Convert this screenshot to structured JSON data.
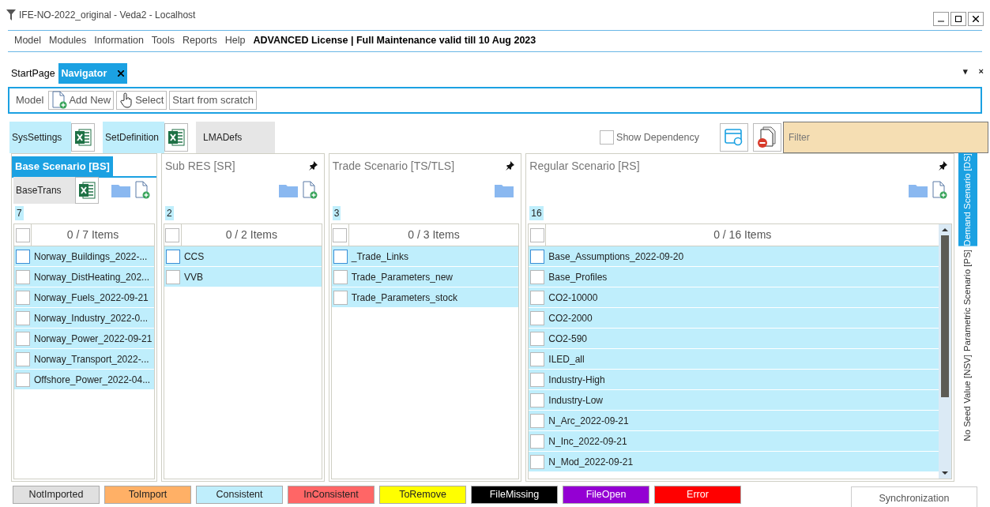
{
  "window": {
    "title": "IFE-NO-2022_original - Veda2 - Localhost"
  },
  "menu": [
    "Model",
    "Modules",
    "Information",
    "Tools",
    "Reports",
    "Help"
  ],
  "license": "ADVANCED License | Full Maintenance valid till 10 Aug 2023",
  "tabs": [
    {
      "label": "StartPage",
      "selected": false,
      "closable": false
    },
    {
      "label": "Navigator",
      "selected": true,
      "closable": true
    }
  ],
  "tab_strip_controls": [
    "▾",
    "×"
  ],
  "toolbar": {
    "label": "Model",
    "buttons": [
      {
        "label": "Add New",
        "kind": "add"
      },
      {
        "label": "Select",
        "kind": "select"
      },
      {
        "label": "Start from scratch",
        "kind": "plain"
      }
    ]
  },
  "files": [
    {
      "label": "SysSettings",
      "color": "#bfeefc",
      "excel": true
    },
    {
      "label": "SetDefinition",
      "color": "#bfeefc",
      "excel": true
    },
    {
      "label": "LMADefs",
      "color": "#e6e6e6",
      "excel": false
    }
  ],
  "show_dependency": {
    "label": "Show Dependency",
    "checked": false
  },
  "filter": {
    "placeholder": "Filter"
  },
  "panels": [
    {
      "title": "Base Scenario [BS]",
      "selected": true,
      "pinned": false,
      "file": {
        "label": "BaseTrans",
        "color": "#e6e6e6"
      },
      "add_file": true,
      "count": "7",
      "summary": "0 / 7 Items",
      "all_checked": false,
      "scrollbar": false,
      "items": [
        {
          "label": "Norway_Buildings_2022-...",
          "checked": false,
          "color": "#bfeefc"
        },
        {
          "label": "Norway_DistHeating_202...",
          "checked": false,
          "color": "#bfeefc"
        },
        {
          "label": "Norway_Fuels_2022-09-21",
          "checked": false,
          "color": "#bfeefc"
        },
        {
          "label": "Norway_Industry_2022-0...",
          "checked": false,
          "color": "#bfeefc"
        },
        {
          "label": "Norway_Power_2022-09-21",
          "checked": false,
          "color": "#bfeefc"
        },
        {
          "label": "Norway_Transport_2022-...",
          "checked": false,
          "color": "#bfeefc"
        },
        {
          "label": "Offshore_Power_2022-04...",
          "checked": false,
          "color": "#bfeefc"
        }
      ]
    },
    {
      "title": "Sub RES [SR]",
      "selected": false,
      "pinned": true,
      "add_file": true,
      "count": "2",
      "summary": "0 / 2 Items",
      "all_checked": false,
      "scrollbar": false,
      "items": [
        {
          "label": "CCS",
          "checked": false,
          "color": "#bfeefc"
        },
        {
          "label": "VVB",
          "checked": false,
          "color": "#bfeefc"
        }
      ]
    },
    {
      "title": "Trade Scenario [TS/TLS]",
      "selected": false,
      "pinned": true,
      "add_file": false,
      "count": "3",
      "summary": "0 / 3 Items",
      "all_checked": false,
      "scrollbar": false,
      "items": [
        {
          "label": "_Trade_Links",
          "checked": false,
          "color": "#bfeefc"
        },
        {
          "label": "Trade_Parameters_new",
          "checked": false,
          "color": "#bfeefc"
        },
        {
          "label": "Trade_Parameters_stock",
          "checked": false,
          "color": "#bfeefc"
        }
      ]
    },
    {
      "title": "Regular Scenario [RS]",
      "selected": false,
      "pinned": true,
      "add_file": true,
      "count": "16",
      "summary": "0 / 16 Items",
      "all_checked": false,
      "scrollbar": true,
      "items": [
        {
          "label": "Base_Assumptions_2022-09-20",
          "checked": false,
          "color": "#bfeefc"
        },
        {
          "label": "Base_Profiles",
          "checked": false,
          "color": "#bfeefc"
        },
        {
          "label": "CO2-10000",
          "checked": false,
          "color": "#bfeefc"
        },
        {
          "label": "CO2-2000",
          "checked": false,
          "color": "#bfeefc"
        },
        {
          "label": "CO2-590",
          "checked": false,
          "color": "#bfeefc"
        },
        {
          "label": "ILED_all",
          "checked": false,
          "color": "#bfeefc"
        },
        {
          "label": "Industry-High",
          "checked": false,
          "color": "#bfeefc"
        },
        {
          "label": "Industry-Low",
          "checked": false,
          "color": "#bfeefc"
        },
        {
          "label": "N_Arc_2022-09-21",
          "checked": false,
          "color": "#bfeefc"
        },
        {
          "label": "N_Inc_2022-09-21",
          "checked": false,
          "color": "#bfeefc"
        },
        {
          "label": "N_Mod_2022-09-21",
          "checked": false,
          "color": "#bfeefc"
        }
      ]
    }
  ],
  "side_tabs": [
    {
      "label": "Demand Scenario [DS]",
      "selected": true
    },
    {
      "label": "Parametric Scenario [PS]",
      "selected": false
    },
    {
      "label": "No Seed Value [NSV]",
      "selected": false
    }
  ],
  "legend": [
    {
      "label": "NotImported",
      "color": "#e0e0e0"
    },
    {
      "label": "ToImport",
      "color": "#ffb066"
    },
    {
      "label": "Consistent",
      "color": "#bfeefc"
    },
    {
      "label": "InConsistent",
      "color": "#ff6666"
    },
    {
      "label": "ToRemove",
      "color": "#ffff00"
    },
    {
      "label": "FileMissing",
      "color": "#000000"
    },
    {
      "label": "FileOpen",
      "color": "#9400d3"
    },
    {
      "label": "Error",
      "color": "#ff0000"
    }
  ],
  "sync_button": "Synchronization"
}
